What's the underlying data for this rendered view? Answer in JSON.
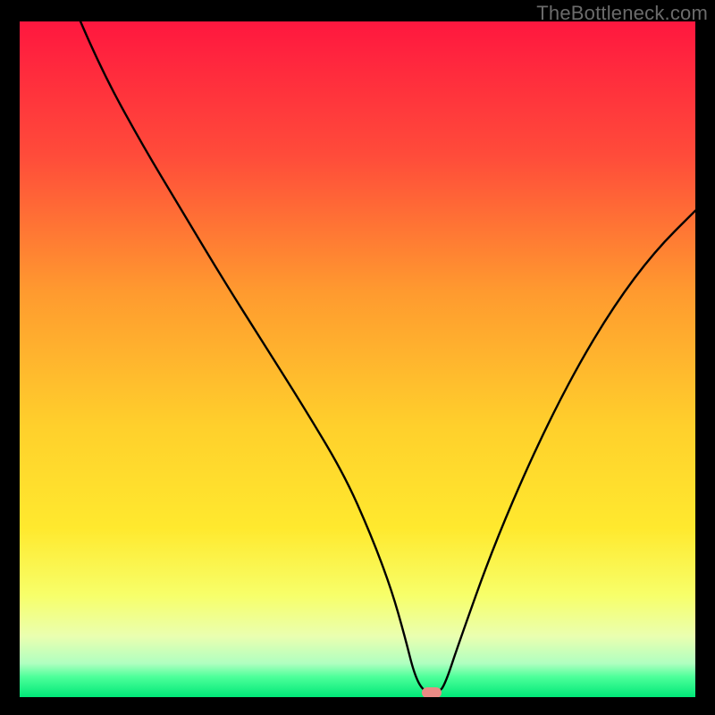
{
  "watermark": "TheBottleneck.com",
  "chart_data": {
    "type": "line",
    "title": "",
    "xlabel": "",
    "ylabel": "",
    "xlim": [
      0,
      100
    ],
    "ylim": [
      0,
      100
    ],
    "gradient_stops": [
      {
        "offset": 0,
        "color": "#ff173f"
      },
      {
        "offset": 20,
        "color": "#ff4c3a"
      },
      {
        "offset": 40,
        "color": "#ff9a2f"
      },
      {
        "offset": 60,
        "color": "#ffd02c"
      },
      {
        "offset": 75,
        "color": "#ffe92e"
      },
      {
        "offset": 85,
        "color": "#f7ff6a"
      },
      {
        "offset": 91,
        "color": "#eaffb0"
      },
      {
        "offset": 95,
        "color": "#b0ffc0"
      },
      {
        "offset": 97,
        "color": "#4dff9a"
      },
      {
        "offset": 100,
        "color": "#00e878"
      }
    ],
    "series": [
      {
        "name": "bottleneck-curve",
        "x": [
          9,
          12,
          18,
          24,
          30,
          36,
          42,
          48,
          52,
          55,
          57,
          58.5,
          60,
          62,
          63,
          65,
          70,
          76,
          82,
          88,
          94,
          100
        ],
        "y": [
          100,
          93,
          82,
          72,
          62,
          52.5,
          43,
          33,
          24,
          16,
          9,
          3,
          0.6,
          0.6,
          2,
          8,
          22,
          36,
          48,
          58,
          66,
          72
        ]
      }
    ],
    "marker": {
      "x": 61,
      "y": 0.6,
      "color": "#e98b85"
    },
    "curve_color": "#000000",
    "curve_width": 2.4
  }
}
